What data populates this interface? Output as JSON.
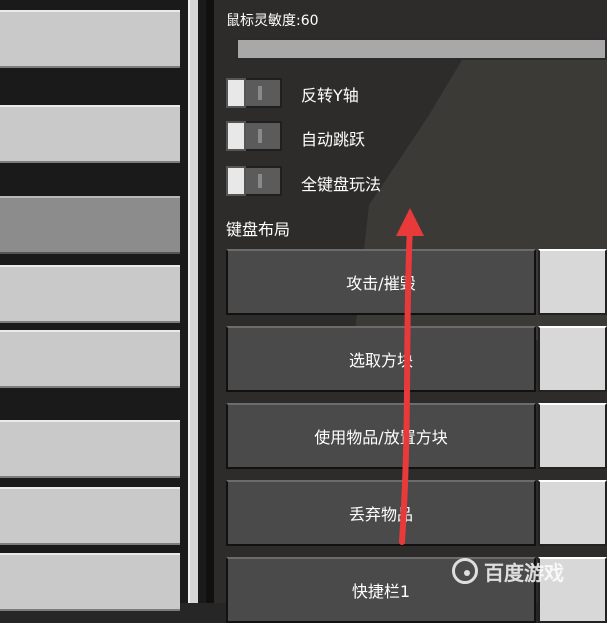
{
  "settings": {
    "sensitivity_label": "鼠标灵敏度:60",
    "sensitivity_value": 60,
    "toggles": [
      {
        "label": "反转Y轴",
        "on": false
      },
      {
        "label": "自动跳跃",
        "on": false
      },
      {
        "label": "全键盘玩法",
        "on": false
      }
    ],
    "keyboard_layout_title": "键盘布局",
    "bindings": [
      {
        "label": "攻击/摧毁"
      },
      {
        "label": "选取方块"
      },
      {
        "label": "使用物品/放置方块"
      },
      {
        "label": "丢弃物品"
      },
      {
        "label": "快捷栏1"
      }
    ]
  },
  "left_menu": {
    "items": [
      {
        "label": ""
      },
      {
        "label": ""
      },
      {
        "label": ""
      },
      {
        "label": ""
      },
      {
        "label": ""
      },
      {
        "label": ""
      },
      {
        "label": ""
      },
      {
        "label": ""
      }
    ],
    "selected_index": 2
  },
  "watermark": {
    "text": "百度游戏",
    "icon": "baidu-game-logo-icon"
  },
  "colors": {
    "arrow": "#e83a3a",
    "button": "#4a4a4a",
    "panel": "#c9c9c9"
  }
}
